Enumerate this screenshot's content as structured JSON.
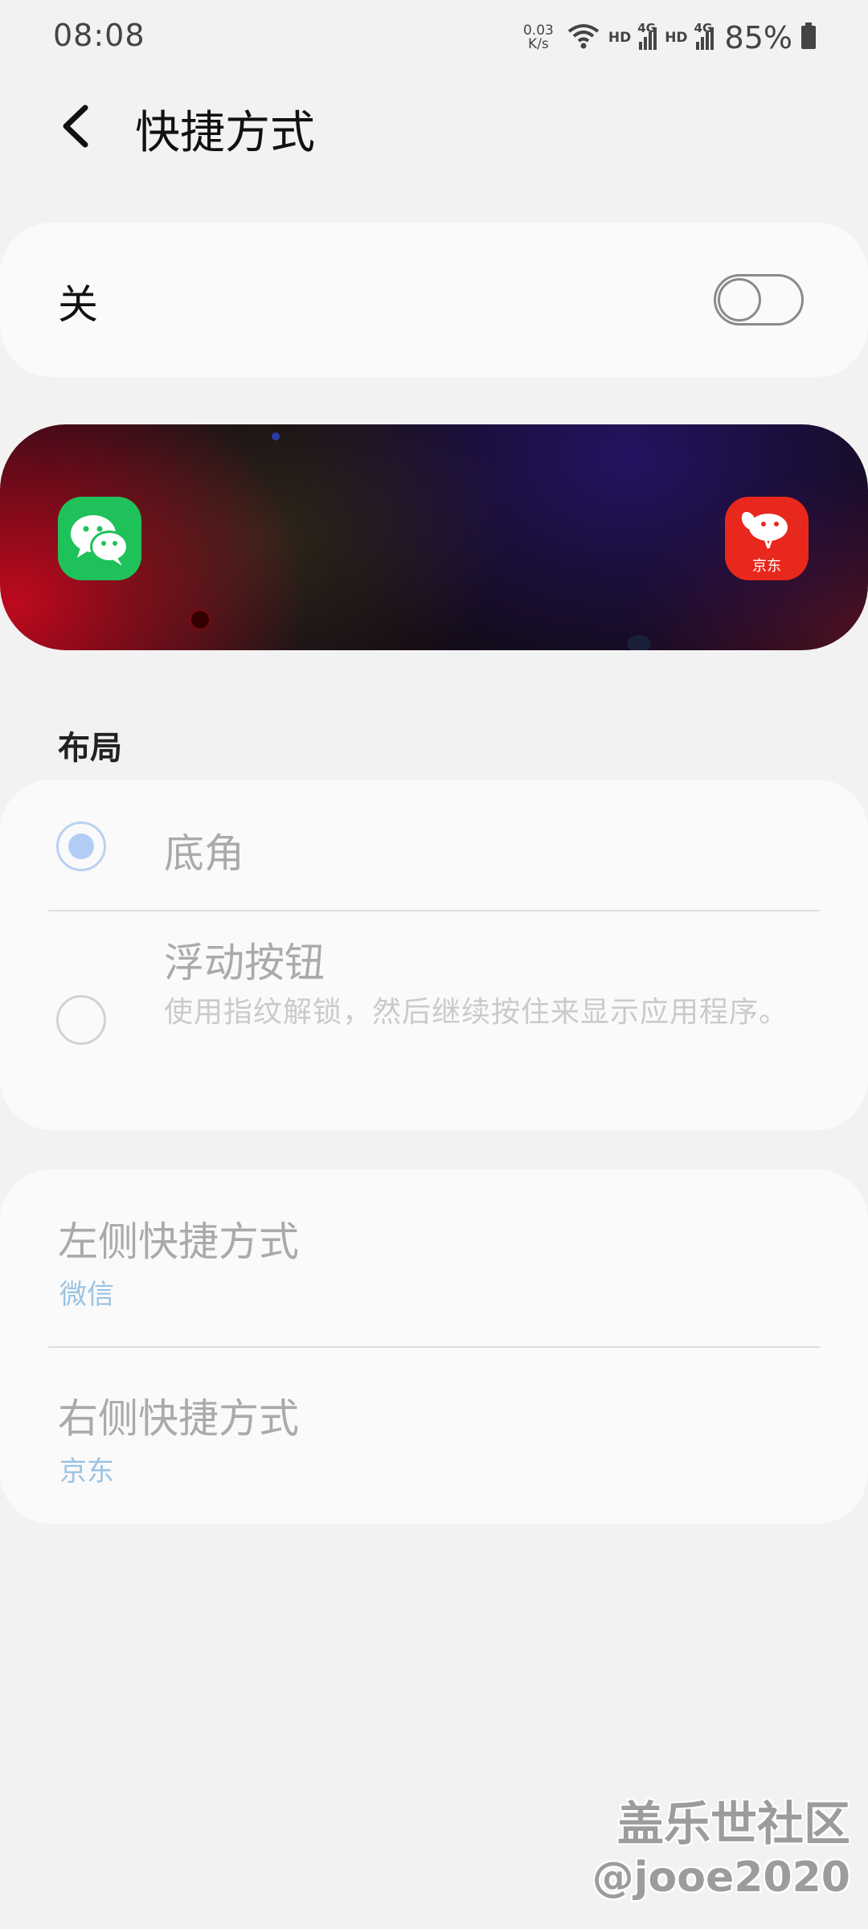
{
  "status_bar": {
    "time": "08:08",
    "net_speed_value": "0.03",
    "net_speed_unit": "K/s",
    "sim1_label": "HD",
    "sim1_network": "4G",
    "sim2_label": "HD",
    "sim2_network": "4G",
    "battery": "85%"
  },
  "header": {
    "title": "快捷方式"
  },
  "master_switch": {
    "label": "关",
    "state": "off"
  },
  "preview": {
    "left_app_icon": "wechat-icon",
    "right_app_icon": "jd-icon",
    "right_app_icon_text": "京东",
    "colors": {
      "wechat": "#1fc25a",
      "jd": "#e8281c"
    }
  },
  "layout_section": {
    "title": "布局",
    "options": [
      {
        "label": "底角",
        "selected": true
      },
      {
        "label": "浮动按钮",
        "description": "使用指纹解锁，然后继续按住来显示应用程序。",
        "selected": false
      }
    ]
  },
  "shortcuts": {
    "left": {
      "title": "左侧快捷方式",
      "value": "微信"
    },
    "right": {
      "title": "右侧快捷方式",
      "value": "京东"
    }
  },
  "watermark": {
    "line1": "盖乐世社区",
    "line2": "@jooe2020"
  }
}
